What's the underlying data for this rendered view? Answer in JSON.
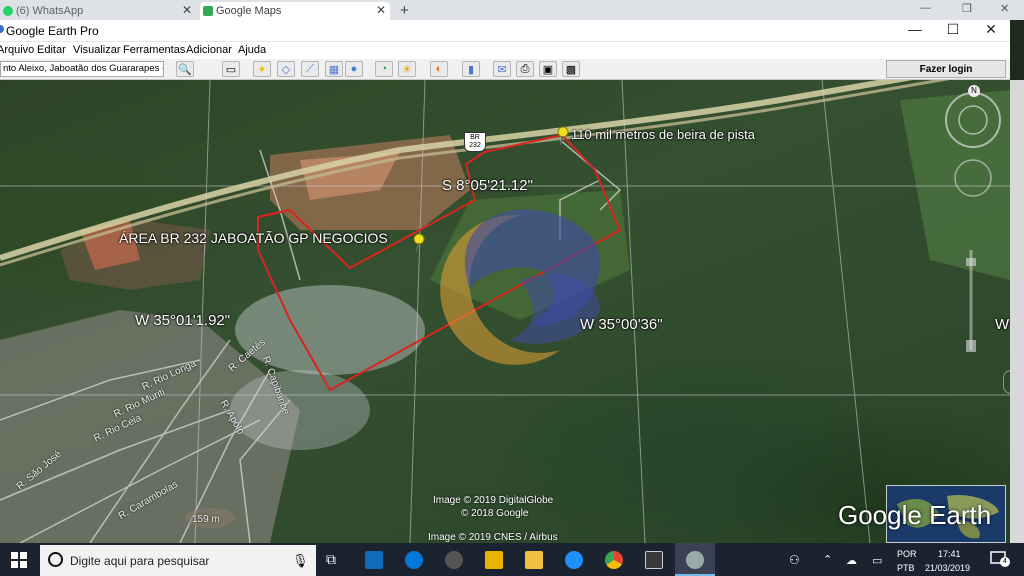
{
  "browser_tabs": [
    {
      "label": "(6) WhatsApp",
      "icon": "whatsapp-icon",
      "active": false
    },
    {
      "label": "Google Maps",
      "icon": "google-maps-icon",
      "active": true
    }
  ],
  "window": {
    "title": "Google Earth Pro"
  },
  "menu": [
    "Arquivo",
    "Editar",
    "Visualizar",
    "Ferramentas",
    "Adicionar",
    "Ajuda"
  ],
  "search": {
    "value": "nto Aleixo, Jaboatão dos Guararapes - PE"
  },
  "toolbar": {
    "login_label": "Fazer login"
  },
  "map": {
    "road_shield": "BR\n232",
    "placemarks": [
      {
        "label": "110 mil metros de beira de pista"
      },
      {
        "label": "ÁREA BR 232 JABOATÃO GP NEGOCIOS"
      }
    ],
    "coords": {
      "lat": "S 8°05'21.12\"",
      "lon_west": "W 35°01'1.92\"",
      "lon_east": "W 35°00'36\"",
      "lon_edge": "W"
    },
    "streets": [
      "R. Rio Longa",
      "R. Rio Muriti",
      "R. Rio Ceia",
      "R. São José",
      "R. Caetés",
      "R. Capibaribe",
      "R. Apolo",
      "R. Carambolas"
    ],
    "elevation": "159 m",
    "credits": [
      "Image © 2019 DigitalGlobe",
      "© 2018 Google",
      "Image © 2019 CNES / Airbus"
    ],
    "brand": "Google Earth",
    "compass_letter": "N"
  },
  "taskbar": {
    "search_placeholder": "Digite aqui para pesquisar",
    "lang_top": "POR",
    "lang_bottom": "PTB",
    "time": "17:41",
    "date": "21/03/2019",
    "notifications": "4"
  },
  "colors": {
    "boundary": "#d8261f",
    "road": "#d9d2a6",
    "watermark_orange": "#e8a035",
    "watermark_blue": "#3f4aa6"
  }
}
